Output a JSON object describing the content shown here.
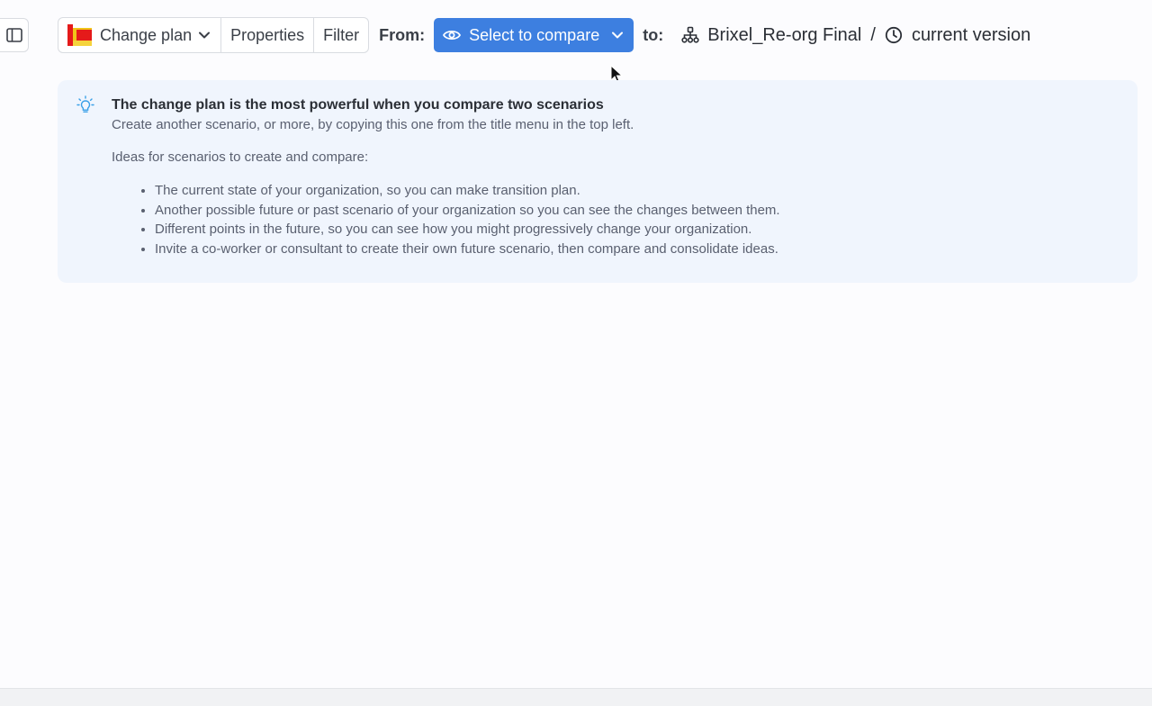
{
  "toolbar": {
    "plan_label": "Change plan",
    "properties_label": "Properties",
    "filter_label": "Filter",
    "from_label": "From:",
    "compare_label": "Select to compare",
    "to_label": "to:",
    "target_name": "Brixel_Re-org Final",
    "separator": "/",
    "target_version": "current version"
  },
  "tip": {
    "title": "The change plan is the most powerful when you compare two scenarios",
    "subtitle": "Create another scenario, or more, by copying this one from the title menu in the top left.",
    "ideas_title": "Ideas for scenarios to create and compare:",
    "ideas": [
      "The current state of your organization, so you can make transition plan.",
      "Another possible future or past scenario of your organization so you can see the changes between them.",
      "Different points in the future, so you can see how you might progressively change your organization.",
      "Invite a co-worker or consultant to create their own future scenario, then compare and consolidate ideas."
    ]
  },
  "icons": {
    "sidebar": "sidebar-panel-icon",
    "plan": "plan-logo-icon",
    "chevron": "chevron-down-icon",
    "eye": "eye-icon",
    "org": "org-chart-icon",
    "clock": "clock-icon",
    "bulb": "lightbulb-icon"
  },
  "colors": {
    "accent": "#3d7fe0",
    "tip_background": "#f0f5fd",
    "bulb": "#3aa0e8"
  }
}
